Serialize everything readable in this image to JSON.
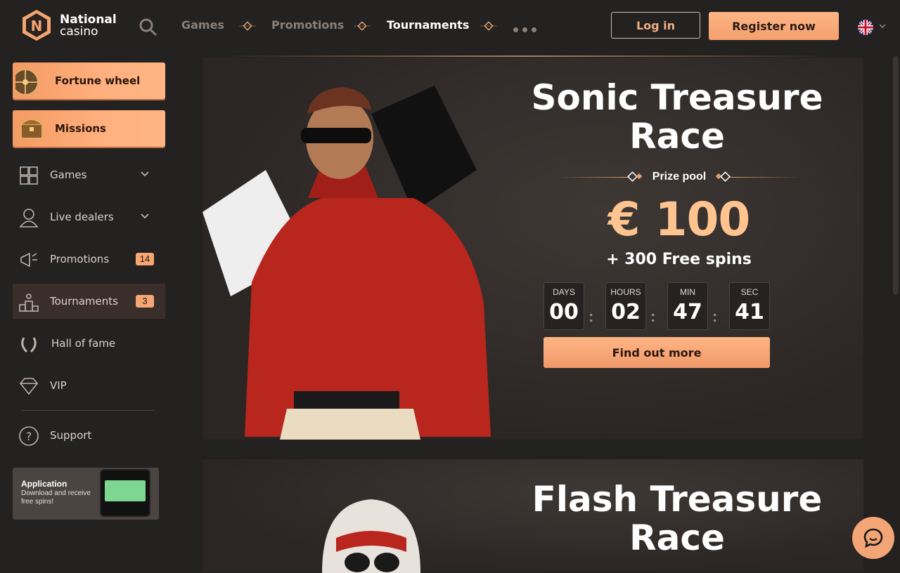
{
  "header": {
    "logo_line1": "National",
    "logo_line2": "casino",
    "nav": [
      "Games",
      "Promotions",
      "Tournaments"
    ],
    "login": "Log in",
    "register": "Register now"
  },
  "sidebar": {
    "fortune_wheel": "Fortune wheel",
    "missions": "Missions",
    "items": [
      {
        "label": "Games",
        "icon": "puzzle-icon"
      },
      {
        "label": "Live dealers",
        "icon": "dealer-icon"
      },
      {
        "label": "Promotions",
        "icon": "megaphone-icon",
        "badge": "14"
      },
      {
        "label": "Tournaments",
        "icon": "podium-icon",
        "badge": "3"
      },
      {
        "label": "Hall of fame",
        "icon": "laurel-icon"
      },
      {
        "label": "VIP",
        "icon": "diamond-icon"
      },
      {
        "label": "Support",
        "icon": "question-icon"
      }
    ],
    "app_title": "Application",
    "app_text": "Download and receive free spins!"
  },
  "tournament1": {
    "title_line1": "Sonic Treasure",
    "title_line2": "Race",
    "prize_label": "Prize pool",
    "amount": "€ 100",
    "extra": "+ 300 Free spins",
    "countdown": [
      {
        "unit": "DAYS",
        "value": "00"
      },
      {
        "unit": "HOURS",
        "value": "02"
      },
      {
        "unit": "MIN",
        "value": "47"
      },
      {
        "unit": "SEC",
        "value": "41"
      }
    ],
    "cta": "Find out more"
  },
  "tournament2": {
    "title_line1": "Flash Treasure",
    "title_line2": "Race"
  },
  "colors": {
    "accent": "#f5a672",
    "bg": "#232020"
  }
}
